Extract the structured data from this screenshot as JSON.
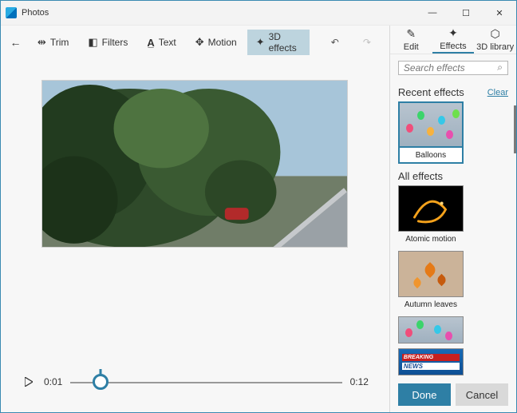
{
  "app": {
    "title": "Photos"
  },
  "window_controls": {
    "min": "—",
    "max": "☐",
    "close": "✕"
  },
  "toolbar": {
    "back": "←",
    "trim": "Trim",
    "filters": "Filters",
    "text": "Text",
    "motion": "Motion",
    "effects3d": "3D effects",
    "undo": "↶",
    "redo": "↷"
  },
  "playback": {
    "current": "0:01",
    "duration": "0:12",
    "progress_pct": 11
  },
  "panel": {
    "tabs": {
      "edit": "Edit",
      "effects": "Effects",
      "library": "3D library"
    },
    "search_placeholder": "Search effects",
    "recent": {
      "title": "Recent effects",
      "clear": "Clear",
      "items": [
        {
          "label": "Balloons"
        }
      ]
    },
    "all": {
      "title": "All effects",
      "items": [
        {
          "label": "Atomic motion"
        },
        {
          "label": "Autumn leaves"
        },
        {
          "label": ""
        },
        {
          "label": ""
        }
      ]
    }
  },
  "footer": {
    "done": "Done",
    "cancel": "Cancel"
  }
}
